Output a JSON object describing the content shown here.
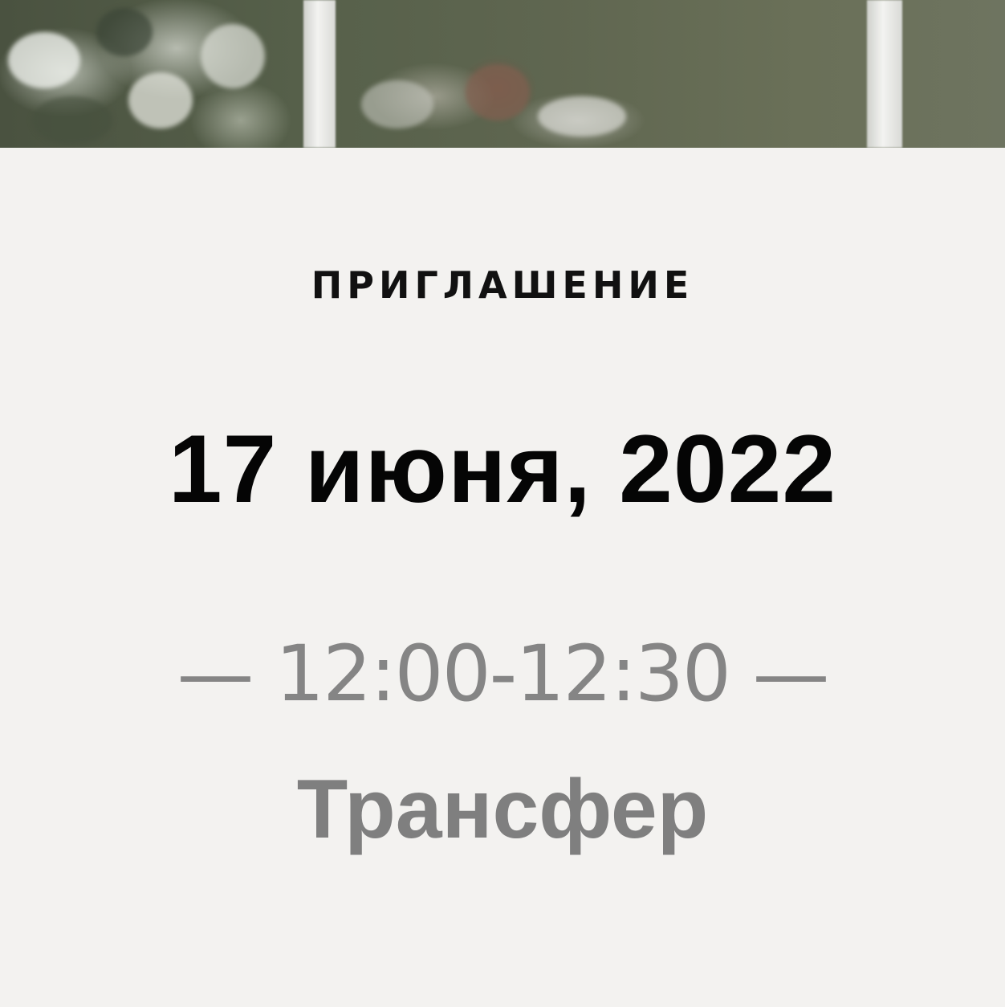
{
  "hero": {
    "image": "wedding-garden-photo"
  },
  "invitation": {
    "eyebrow": "ПРИГЛАШЕНИЕ",
    "date": "17 июня, 2022",
    "time": "— 12:00-12:30 —",
    "event": "Трансфер"
  },
  "colors": {
    "background": "#f3f2f0",
    "date_text": "#050505",
    "time_text": "#858585",
    "event_text": "#7f7f7f"
  }
}
